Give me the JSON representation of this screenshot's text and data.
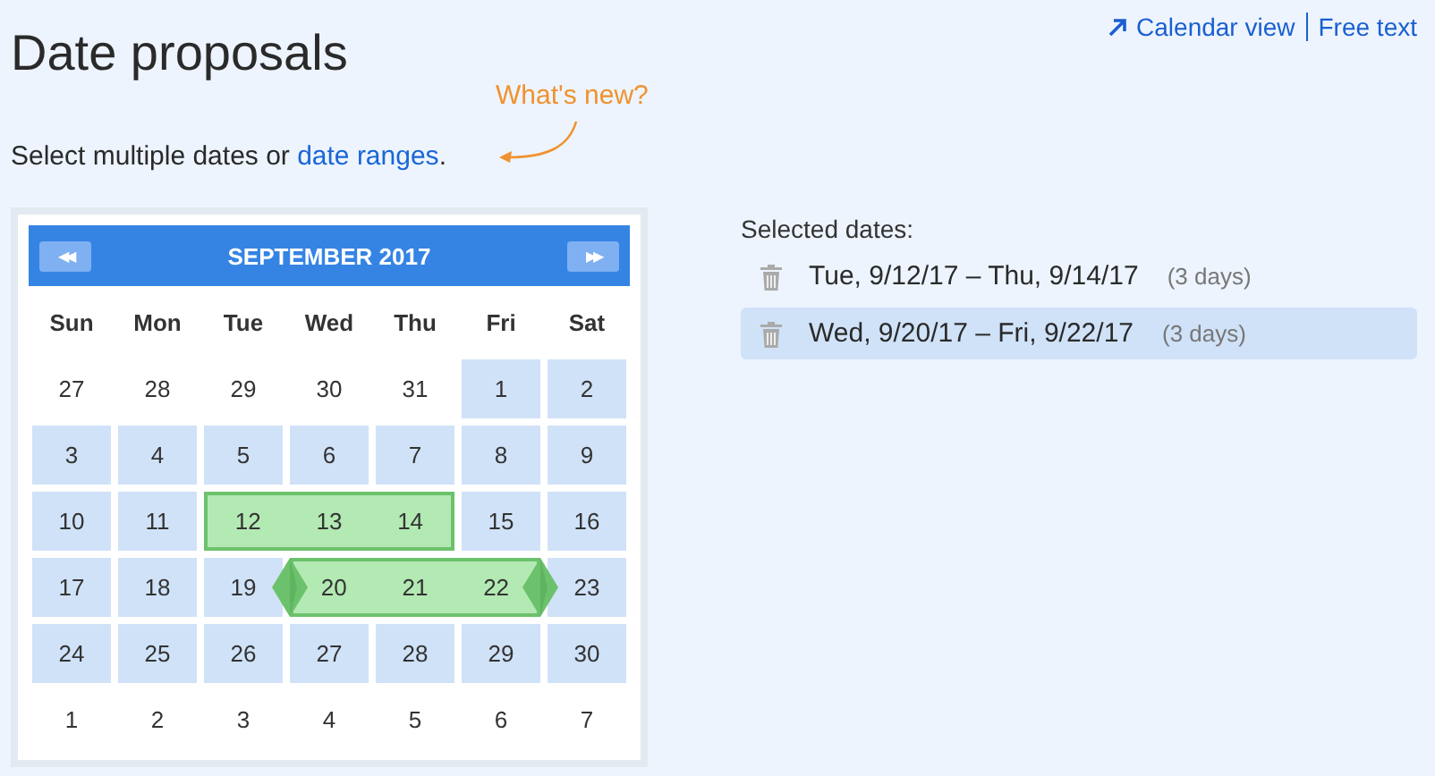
{
  "title": "Date proposals",
  "links": [
    {
      "kind": "external",
      "label": "Calendar view"
    },
    {
      "kind": "plain",
      "label": "Free text"
    }
  ],
  "whats_new": "What's new?",
  "intro": {
    "text": "Select multiple dates or ",
    "link": "date ranges",
    "end": "."
  },
  "calendar": {
    "month": "SEPTEMBER",
    "year": "2017",
    "prev": "◀◀",
    "next": "▶▶",
    "weekdays": [
      "Sun",
      "Mon",
      "Tue",
      "Wed",
      "Thu",
      "Fri",
      "Sat"
    ],
    "weeks": [
      [
        {
          "kind": "day",
          "day": "27",
          "in_month": false
        },
        {
          "kind": "day",
          "day": "28",
          "in_month": false
        },
        {
          "kind": "day",
          "day": "29",
          "in_month": false
        },
        {
          "kind": "day",
          "day": "30",
          "in_month": false
        },
        {
          "kind": "day",
          "day": "31",
          "in_month": false
        },
        {
          "kind": "day",
          "day": "1",
          "in_month": true
        },
        {
          "kind": "day",
          "day": "2",
          "in_month": true
        }
      ],
      [
        {
          "kind": "day",
          "day": "3",
          "in_month": true
        },
        {
          "kind": "day",
          "day": "4",
          "in_month": true
        },
        {
          "kind": "day",
          "day": "5",
          "in_month": true
        },
        {
          "kind": "day",
          "day": "6",
          "in_month": true
        },
        {
          "kind": "day",
          "day": "7",
          "in_month": true
        },
        {
          "kind": "day",
          "day": "8",
          "in_month": true
        },
        {
          "kind": "day",
          "day": "9",
          "in_month": true
        }
      ],
      [
        {
          "kind": "day",
          "day": "10",
          "in_month": true
        },
        {
          "kind": "day",
          "day": "11",
          "in_month": true
        },
        {
          "kind": "range",
          "days": [
            "12",
            "13",
            "14"
          ],
          "active": false
        },
        {
          "kind": "day",
          "day": "15",
          "in_month": true
        },
        {
          "kind": "day",
          "day": "16",
          "in_month": true
        }
      ],
      [
        {
          "kind": "day",
          "day": "17",
          "in_month": true
        },
        {
          "kind": "day",
          "day": "18",
          "in_month": true
        },
        {
          "kind": "day",
          "day": "19",
          "in_month": true
        },
        {
          "kind": "range",
          "days": [
            "20",
            "21",
            "22"
          ],
          "active": true
        },
        {
          "kind": "day",
          "day": "23",
          "in_month": true
        }
      ],
      [
        {
          "kind": "day",
          "day": "24",
          "in_month": true
        },
        {
          "kind": "day",
          "day": "25",
          "in_month": true
        },
        {
          "kind": "day",
          "day": "26",
          "in_month": true
        },
        {
          "kind": "day",
          "day": "27",
          "in_month": true
        },
        {
          "kind": "day",
          "day": "28",
          "in_month": true
        },
        {
          "kind": "day",
          "day": "29",
          "in_month": true
        },
        {
          "kind": "day",
          "day": "30",
          "in_month": true
        }
      ],
      [
        {
          "kind": "day",
          "day": "1",
          "in_month": false
        },
        {
          "kind": "day",
          "day": "2",
          "in_month": false
        },
        {
          "kind": "day",
          "day": "3",
          "in_month": false
        },
        {
          "kind": "day",
          "day": "4",
          "in_month": false
        },
        {
          "kind": "day",
          "day": "5",
          "in_month": false
        },
        {
          "kind": "day",
          "day": "6",
          "in_month": false
        },
        {
          "kind": "day",
          "day": "7",
          "in_month": false
        }
      ]
    ]
  },
  "selected_dates": {
    "heading": "Selected dates:",
    "items": [
      {
        "label": "Tue, 9/12/17 – Thu, 9/14/17",
        "count": "(3 days)",
        "selected": false
      },
      {
        "label": "Wed, 9/20/17 – Fri, 9/22/17",
        "count": "(3 days)",
        "selected": true
      }
    ]
  }
}
